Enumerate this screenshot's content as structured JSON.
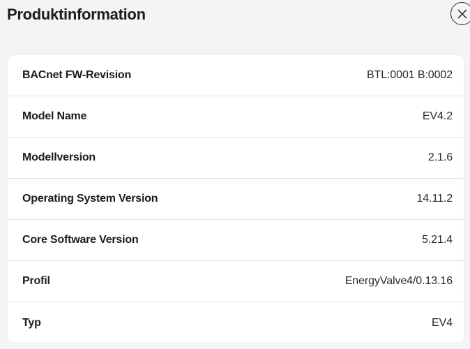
{
  "dialog": {
    "title": "Produktinformation",
    "close_icon": "close-icon"
  },
  "rows": [
    {
      "label": "BACnet FW-Revision",
      "value": "BTL:0001 B:0002"
    },
    {
      "label": "Model Name",
      "value": "EV4.2"
    },
    {
      "label": "Modellversion",
      "value": "2.1.6"
    },
    {
      "label": "Operating System Version",
      "value": "14.11.2"
    },
    {
      "label": "Core Software Version",
      "value": "5.21.4"
    },
    {
      "label": "Profil",
      "value": "EnergyValve4/0.13.16"
    },
    {
      "label": "Typ",
      "value": "EV4"
    }
  ]
}
